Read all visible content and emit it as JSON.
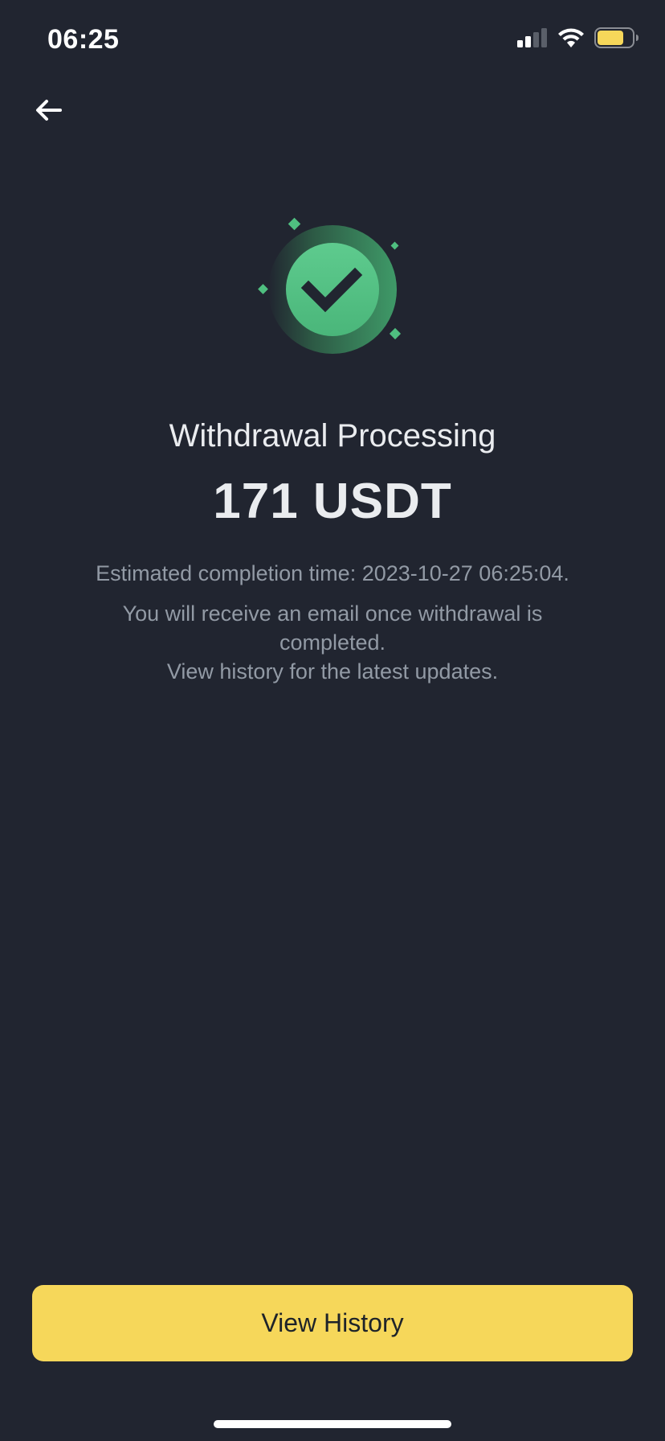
{
  "status_bar": {
    "time": "06:25",
    "icons": [
      "cellular-signal-icon",
      "wifi-icon",
      "battery-icon"
    ]
  },
  "nav": {
    "back_icon": "arrow-left-icon"
  },
  "success": {
    "icon": "checkmark-icon",
    "accent_color": "#4FBF80"
  },
  "main": {
    "title": "Withdrawal Processing",
    "amount": "171 USDT",
    "estimated_time": "Estimated completion time: 2023-10-27 06:25:04.",
    "info_line_1": "You will receive an email once withdrawal is completed.",
    "info_line_2": "View history for the latest updates."
  },
  "actions": {
    "view_history_label": "View History",
    "button_color": "#F6D75A"
  }
}
